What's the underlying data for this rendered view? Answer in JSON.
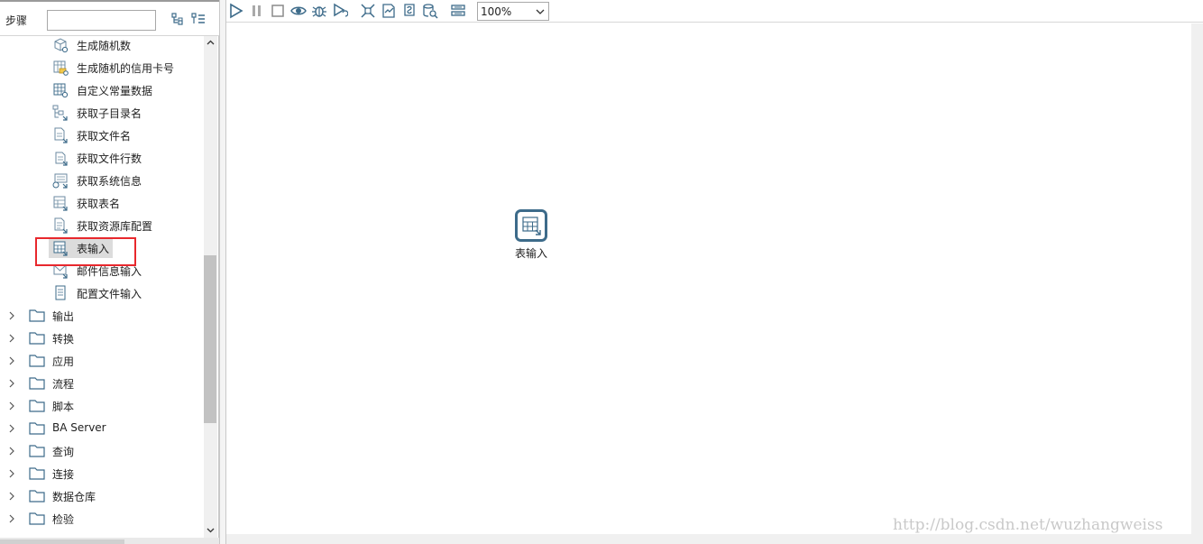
{
  "steps_panel": {
    "title": "步骤",
    "search_value": "",
    "items": [
      {
        "label": "生成随机数",
        "icon": "dice-table-icon"
      },
      {
        "label": "生成随机的信用卡号",
        "icon": "card-table-icon"
      },
      {
        "label": "自定义常量数据",
        "icon": "constant-table-icon"
      },
      {
        "label": "获取子目录名",
        "icon": "subfolder-icon"
      },
      {
        "label": "获取文件名",
        "icon": "file-name-icon"
      },
      {
        "label": "获取文件行数",
        "icon": "file-rows-icon"
      },
      {
        "label": "获取系统信息",
        "icon": "system-info-icon"
      },
      {
        "label": "获取表名",
        "icon": "table-name-icon"
      },
      {
        "label": "获取资源库配置",
        "icon": "repository-config-icon"
      },
      {
        "label": "表输入",
        "icon": "table-input-icon",
        "selected": true
      },
      {
        "label": "邮件信息输入",
        "icon": "mail-input-icon"
      },
      {
        "label": "配置文件输入",
        "icon": "config-file-icon"
      }
    ],
    "folders": [
      {
        "label": "输出"
      },
      {
        "label": "转换"
      },
      {
        "label": "应用"
      },
      {
        "label": "流程"
      },
      {
        "label": "脚本"
      },
      {
        "label": "BA Server"
      },
      {
        "label": "查询"
      },
      {
        "label": "连接"
      },
      {
        "label": "数据仓库"
      },
      {
        "label": "检验"
      }
    ]
  },
  "toolbar": {
    "zoom": "100%"
  },
  "canvas": {
    "steps": [
      {
        "label": "表输入",
        "icon": "table-input-icon"
      }
    ]
  },
  "watermark": "http://blog.csdn.net/wuzhangweiss",
  "colors": {
    "icon_blue": "#3d6b8a",
    "highlight_red": "#e8282d",
    "selected_bg": "#dcdcdc"
  }
}
